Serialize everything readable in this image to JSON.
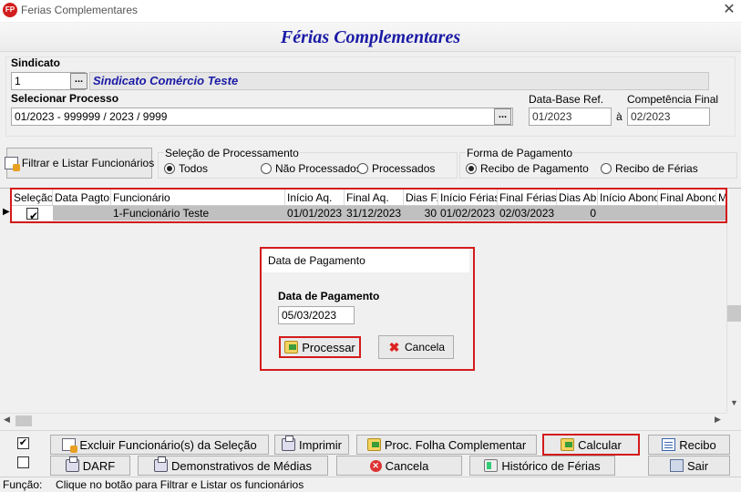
{
  "window": {
    "title": "Ferias Complementares",
    "app_icon_text": "FP"
  },
  "banner": {
    "title": "Férias Complementares"
  },
  "sindicato": {
    "label": "Sindicato",
    "code": "1",
    "name": "Sindicato Comércio Teste",
    "lookup_label": "..."
  },
  "processo": {
    "label": "Selecionar Processo",
    "value": "01/2023 - 999999 / 2023 / 9999",
    "lookup_label": "..."
  },
  "data_base": {
    "label": "Data-Base Ref.",
    "value": "01/2023",
    "separator": "à"
  },
  "competencia": {
    "label": "Competência Final",
    "value": "02/2023"
  },
  "filter_button": {
    "label": "Filtrar e Listar Funcionários"
  },
  "selecao": {
    "label": "Seleção de Processamento",
    "options": [
      "Todos",
      "Não Processados",
      "Processados"
    ],
    "selected": "Todos"
  },
  "forma": {
    "label": "Forma de Pagamento",
    "options": [
      "Recibo de Pagamento",
      "Recibo de Férias"
    ],
    "selected": "Recibo de Pagamento"
  },
  "grid": {
    "columns": [
      "Seleção",
      "Data Pagto",
      "Funcionário",
      "Início Aq.",
      "Final Aq.",
      "Dias F.",
      "Início Férias",
      "Final Férias",
      "Dias Ab.",
      "Início Abono",
      "Final Abono",
      "M"
    ],
    "rows": [
      {
        "selected": "✔",
        "data_pagto": "",
        "funcionario": "1-Funcionário Teste",
        "inicio_aq": "01/01/2023",
        "final_aq": "31/12/2023",
        "dias_f": "30",
        "inicio_ferias": "01/02/2023",
        "final_ferias": "02/03/2023",
        "dias_ab": "0",
        "inicio_abono": "",
        "final_abono": ""
      }
    ]
  },
  "dialog": {
    "title": "Data de Pagamento",
    "field_label": "Data de Pagamento",
    "field_value": "05/03/2023",
    "process_label": "Processar",
    "cancel_label": "Cancela"
  },
  "footer": {
    "check1": "✔",
    "buttons": {
      "excluir": "Excluir Funcionário(s) da Seleção",
      "imprimir": "Imprimir",
      "proc_folha": "Proc. Folha Complementar",
      "calcular": "Calcular",
      "recibo": "Recibo",
      "darf": "DARF",
      "demonstrativos": "Demonstrativos de Médias",
      "cancela": "Cancela",
      "historico": "Histórico de Férias",
      "sair": "Sair"
    }
  },
  "status": {
    "label": "Função:",
    "text": "Clique no botão para Filtrar e Listar os funcionários"
  }
}
